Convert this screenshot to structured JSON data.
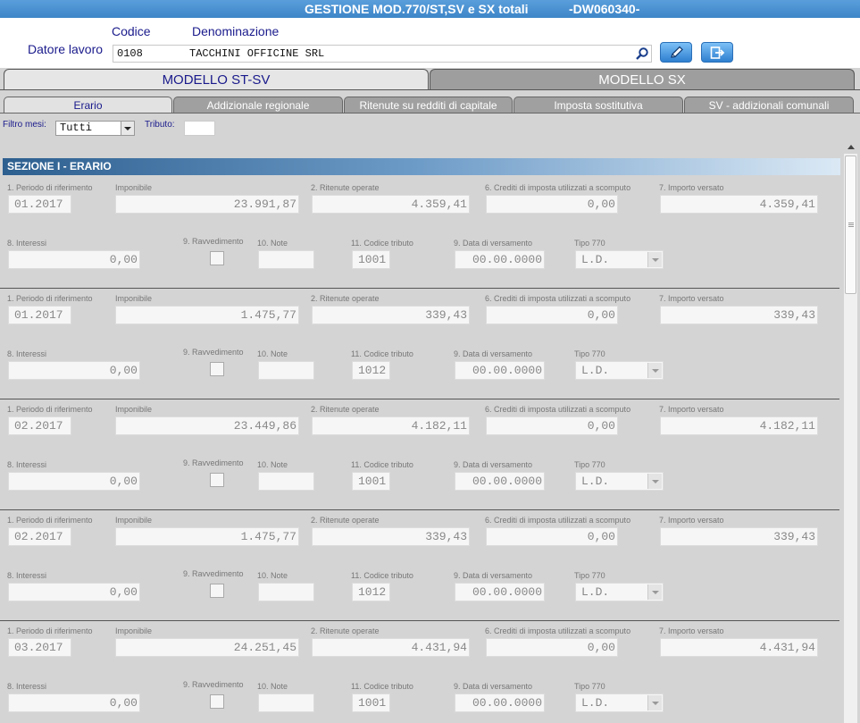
{
  "title": {
    "main": "GESTIONE MOD.770/ST,SV e SX totali",
    "code": "-DW060340-"
  },
  "header": {
    "datore_label": "Datore lavoro",
    "codice_label": "Codice",
    "denominazione_label": "Denominazione",
    "codice_value": "0108",
    "denominazione_value": "TACCHINI OFFICINE SRL"
  },
  "main_tabs": [
    {
      "label": "MODELLO ST-SV"
    },
    {
      "label": "MODELLO SX"
    }
  ],
  "sub_tabs": [
    {
      "label": "Erario"
    },
    {
      "label": "Addizionale regionale"
    },
    {
      "label": "Ritenute su redditi di capitale"
    },
    {
      "label": "Imposta sostitutiva"
    },
    {
      "label": "SV - addizionali comunali"
    }
  ],
  "filter": {
    "mesi_label": "Filtro mesi:",
    "mesi_value": "Tutti",
    "tributo_label": "Tributo:",
    "tributo_value": ""
  },
  "section": {
    "title": "SEZIONE I - ERARIO"
  },
  "labels": {
    "periodo": "1. Periodo di riferimento",
    "imponibile": "Imponibile",
    "ritenute": "2. Ritenute operate",
    "crediti": "6. Crediti di imposta utilizzati a scomputo",
    "importo": "7. Importo versato",
    "interessi": "8. Interessi",
    "ravvedimento": "9. Ravvedimento",
    "note": "10. Note",
    "codice_tributo": "11. Codice tributo",
    "data_versamento": "9. Data di versamento",
    "tipo770": "Tipo 770"
  },
  "records": [
    {
      "periodo": "01.2017",
      "imponibile": "23.991,87",
      "ritenute": "4.359,41",
      "crediti": "0,00",
      "importo": "4.359,41",
      "interessi": "0,00",
      "ravvedimento": false,
      "note": "",
      "codice_tributo": "1001",
      "data_versamento": "00.00.0000",
      "tipo770": "L.D."
    },
    {
      "periodo": "01.2017",
      "imponibile": "1.475,77",
      "ritenute": "339,43",
      "crediti": "0,00",
      "importo": "339,43",
      "interessi": "0,00",
      "ravvedimento": false,
      "note": "",
      "codice_tributo": "1012",
      "data_versamento": "00.00.0000",
      "tipo770": "L.D."
    },
    {
      "periodo": "02.2017",
      "imponibile": "23.449,86",
      "ritenute": "4.182,11",
      "crediti": "0,00",
      "importo": "4.182,11",
      "interessi": "0,00",
      "ravvedimento": false,
      "note": "",
      "codice_tributo": "1001",
      "data_versamento": "00.00.0000",
      "tipo770": "L.D."
    },
    {
      "periodo": "02.2017",
      "imponibile": "1.475,77",
      "ritenute": "339,43",
      "crediti": "0,00",
      "importo": "339,43",
      "interessi": "0,00",
      "ravvedimento": false,
      "note": "",
      "codice_tributo": "1012",
      "data_versamento": "00.00.0000",
      "tipo770": "L.D."
    },
    {
      "periodo": "03.2017",
      "imponibile": "24.251,45",
      "ritenute": "4.431,94",
      "crediti": "0,00",
      "importo": "4.431,94",
      "interessi": "0,00",
      "ravvedimento": false,
      "note": "",
      "codice_tributo": "1001",
      "data_versamento": "00.00.0000",
      "tipo770": "L.D."
    }
  ],
  "colors": {
    "title_bar": "#3d85c8",
    "label_blue": "#1a1a8c",
    "section_header": "#2d5f8f",
    "background": "#d4d4d4"
  }
}
